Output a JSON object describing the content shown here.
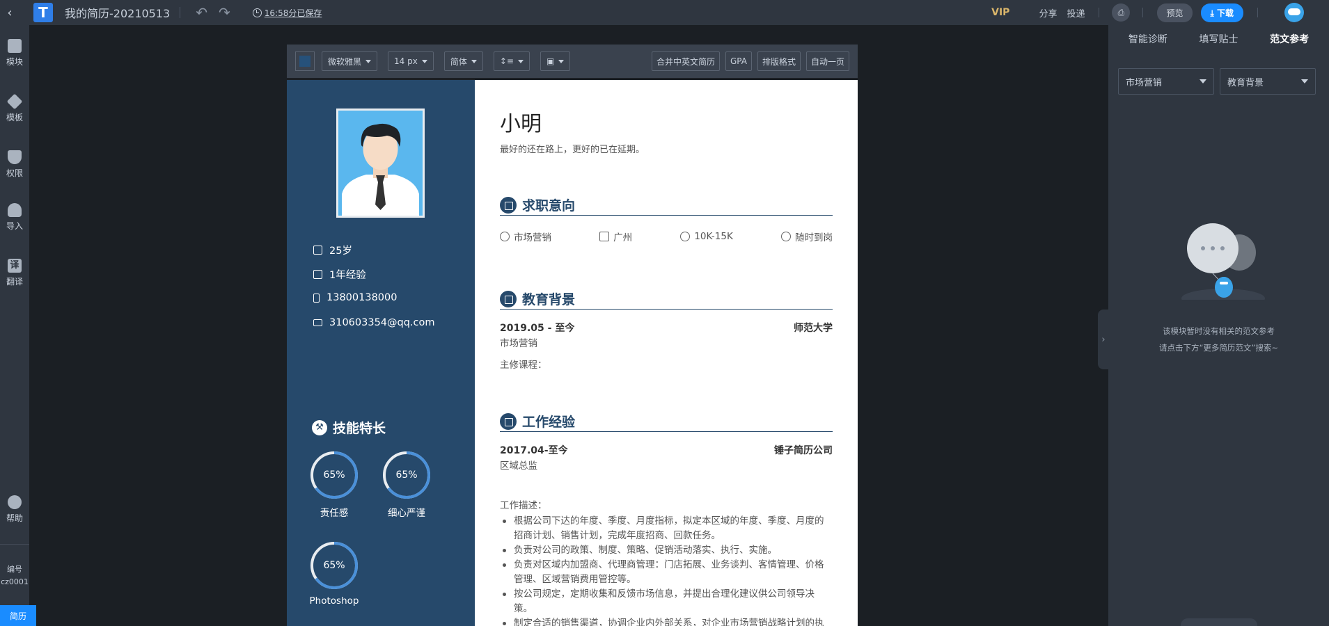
{
  "topbar": {
    "title": "我的简历-20210513",
    "saved": "16:58分已保存",
    "vip": "VIP",
    "share": "分享",
    "deliver": "投递",
    "preview": "预览",
    "download": "下载"
  },
  "leftbar": {
    "items": [
      {
        "label": "模块",
        "icon": "modules-icon"
      },
      {
        "label": "模板",
        "icon": "layers-icon"
      },
      {
        "label": "权限",
        "icon": "shield-icon"
      },
      {
        "label": "导入",
        "icon": "cloud-upload-icon"
      },
      {
        "label": "翻译",
        "icon": "translate-icon",
        "glyph": "译"
      }
    ],
    "help": "帮助",
    "code_label": "编号",
    "code_value": "cz0001",
    "resume_tab": "简历"
  },
  "toolbar": {
    "theme_color": "#26517a",
    "font": "微软雅黑",
    "size": "14 px",
    "script": "简体",
    "merge": "合并中英文简历",
    "gpa": "GPA",
    "format": "排版格式",
    "one_page": "自动一页"
  },
  "resume": {
    "name": "小明",
    "motto": "最好的还在路上，更好的已在延期。",
    "age": "25岁",
    "experience": "1年经验",
    "phone": "13800138000",
    "email": "310603354@qq.com",
    "skills_title": "技能特长",
    "skills": [
      {
        "name": "责任感",
        "percent_label": "65%",
        "percent": 0.65
      },
      {
        "name": "细心严谨",
        "percent_label": "65%",
        "percent": 0.65
      },
      {
        "name": "Photoshop",
        "percent_label": "65%",
        "percent": 0.65
      }
    ],
    "intent": {
      "title": "求职意向",
      "position": "市场营销",
      "city": "广州",
      "salary": "10K-15K",
      "availability": "随时到岗"
    },
    "education": {
      "title": "教育背景",
      "period": "2019.05 - 至今",
      "school": "师范大学",
      "major": "市场营销",
      "courses": "主修课程："
    },
    "work": {
      "title": "工作经验",
      "period": "2017.04-至今",
      "company": "锤子简历公司",
      "role": "区域总监",
      "desc_label": "工作描述：",
      "bullets": [
        "根据公司下达的年度、季度、月度指标，拟定本区域的年度、季度、月度的招商计划、销售计划，完成年度招商、回款任务。",
        "负责对公司的政策、制度、策略、促销活动落实、执行、实施。",
        "负责对区域内加盟商、代理商管理：门店拓展、业务谈判、客情管理、价格管理、区域营销费用管控等。",
        "按公司规定，定期收集和反馈市场信息，并提出合理化建议供公司领导决策。",
        "制定合适的销售渠道，协调企业内外部关系，对企业市场营销战略计划的执行进行监督和控制。"
      ]
    }
  },
  "rightpanel": {
    "tabs": [
      "智能诊断",
      "填写贴士",
      "范文参考"
    ],
    "active_tab": "范文参考",
    "select1": "市场营销",
    "select2": "教育背景",
    "empty_line1": "该模块暂时没有相关的范文参考",
    "empty_line2": "请点击下方“更多简历范文”搜索~"
  }
}
